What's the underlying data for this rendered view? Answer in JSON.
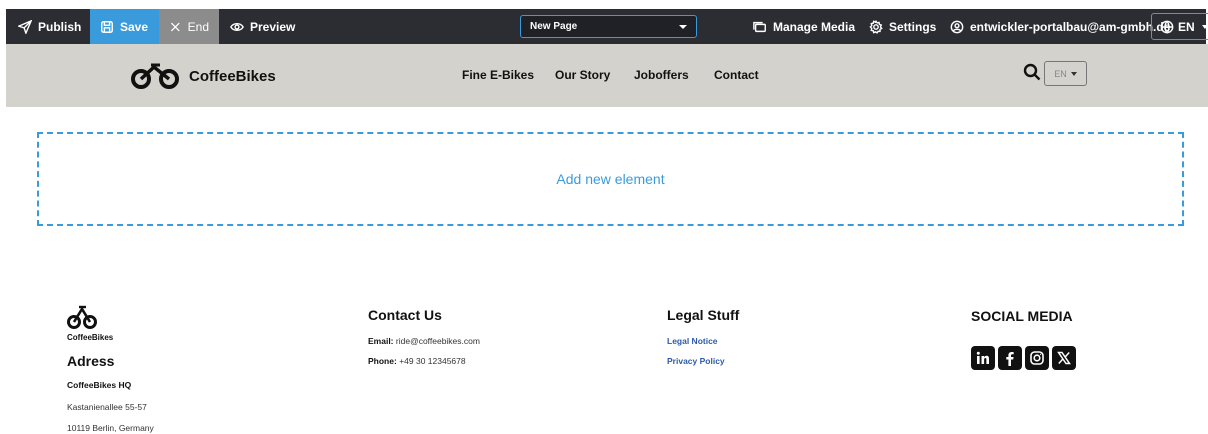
{
  "editor_toolbar": {
    "publish": "Publish",
    "save": "Save",
    "end": "End",
    "preview": "Preview",
    "page_select": "New Page",
    "manage_media": "Manage Media",
    "settings": "Settings",
    "user_email": "entwickler-portalbau@am-gmbh.de",
    "language": "EN"
  },
  "site_header": {
    "brand": "CoffeeBikes",
    "nav": [
      "Fine E-Bikes",
      "Our Story",
      "Joboffers",
      "Contact"
    ],
    "language_select": "EN"
  },
  "editor": {
    "add_element": "Add new element"
  },
  "footer": {
    "logo_label": "CoffeeBikes",
    "address": {
      "heading": "Adress",
      "company": "CoffeeBikes HQ",
      "street": "Kastanienallee 55-57",
      "city": "10119 Berlin, Germany"
    },
    "contact": {
      "heading": "Contact Us",
      "email_label": "Email:",
      "email": "ride@coffeebikes.com",
      "phone_label": "Phone:",
      "phone": "+49 30 12345678"
    },
    "legal": {
      "heading": "Legal Stuff",
      "links": [
        "Legal Notice",
        "Privacy Policy"
      ]
    },
    "social": {
      "heading": "SOCIAL MEDIA",
      "icons": [
        "linkedin-icon",
        "facebook-icon",
        "instagram-icon",
        "x-icon"
      ]
    }
  },
  "colors": {
    "toolbar_bg": "#2b2d33",
    "save_accent": "#3a9bdc",
    "end_bg": "#8c8c8c",
    "header_bg": "#d3d2cd",
    "link": "#2d5aa8"
  }
}
